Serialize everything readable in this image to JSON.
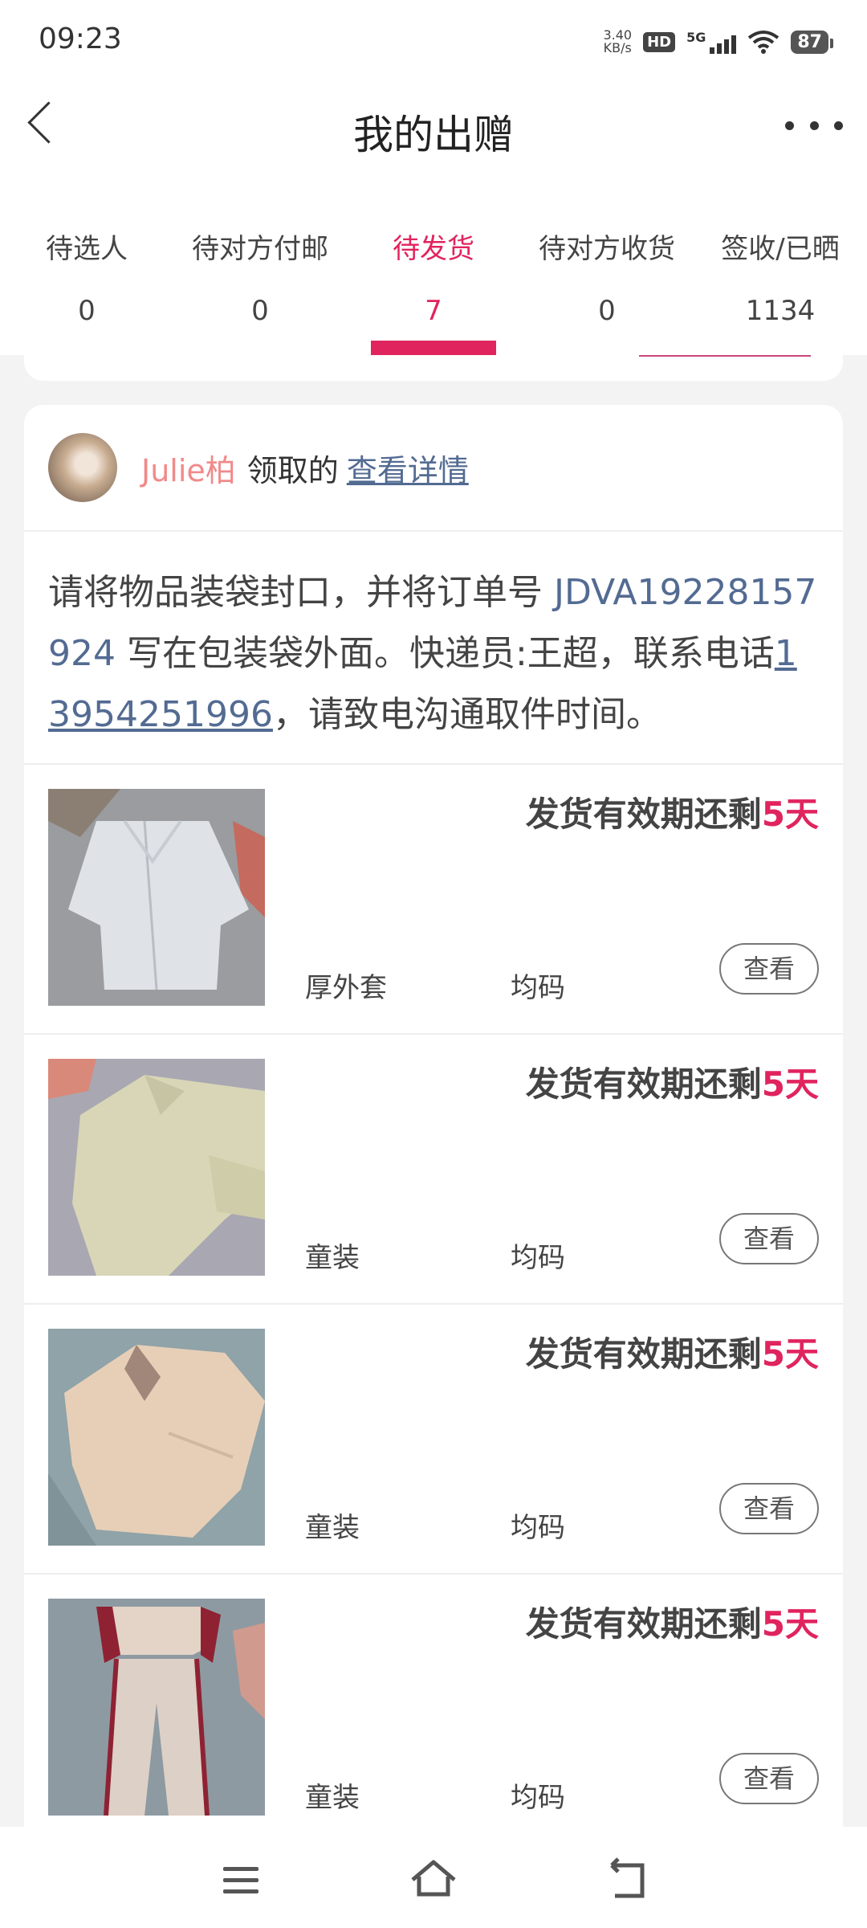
{
  "status_bar": {
    "time": "09:23",
    "net_speed_value": "3.40",
    "net_speed_unit": "KB/s",
    "hd": "HD",
    "network": "5G",
    "battery": "87"
  },
  "header": {
    "title": "我的出赠",
    "back_icon": "chevron-left-icon",
    "more_icon": "more-horizontal-icon"
  },
  "tabs": [
    {
      "label": "待选人",
      "count": "0"
    },
    {
      "label": "待对方付邮",
      "count": "0"
    },
    {
      "label": "待发货",
      "count": "7",
      "active": true
    },
    {
      "label": "待对方收货",
      "count": "0"
    },
    {
      "label": "签收/已晒",
      "count": "1134"
    }
  ],
  "claim": {
    "name": "Julie柏",
    "action": "领取的",
    "detail_link": "查看详情"
  },
  "instructions": {
    "part1": "请将物品装袋封口，并将订单号 ",
    "order_number": "JDVA19228157924",
    "part2": " 写在包装袋外面。快递员:王超，联系电话",
    "phone": "13954251996",
    "part3": "，请致电沟通取件时间。"
  },
  "items": [
    {
      "deadline_prefix": "发货有效期还剩",
      "deadline_days": "5天",
      "category": "厚外套",
      "size": "均码",
      "view_label": "查看"
    },
    {
      "deadline_prefix": "发货有效期还剩",
      "deadline_days": "5天",
      "category": "童装",
      "size": "均码",
      "view_label": "查看"
    },
    {
      "deadline_prefix": "发货有效期还剩",
      "deadline_days": "5天",
      "category": "童装",
      "size": "均码",
      "view_label": "查看"
    },
    {
      "deadline_prefix": "发货有效期还剩",
      "deadline_days": "5天",
      "category": "童装",
      "size": "均码",
      "view_label": "查看"
    }
  ],
  "colors": {
    "accent": "#e0245e",
    "link": "#536b92",
    "claimer_name": "#f08a8a"
  },
  "nav_icons": [
    "menu-icon",
    "home-icon",
    "back-icon"
  ]
}
